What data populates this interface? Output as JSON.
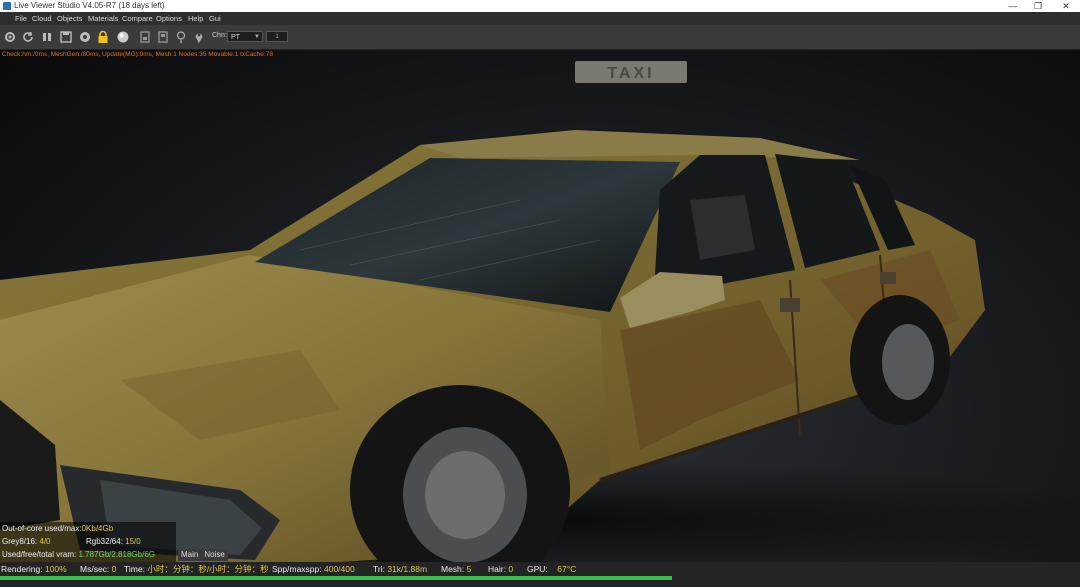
{
  "window": {
    "title": "Live Viewer Studio V4.05-R7 (18 days left)",
    "controls": [
      "—",
      "❐",
      "✕"
    ]
  },
  "menu": [
    "File",
    "Cloud",
    "Objects",
    "Materials",
    "Compare",
    "Options",
    "Help",
    "Gui"
  ],
  "toolbar": {
    "icons": [
      "gear-icon",
      "refresh-icon",
      "pause-icon",
      "save-icon",
      "settings-icon",
      "lock-icon",
      "sphere-icon",
      "region-icon",
      "region-icon",
      "locator-icon",
      "locator-icon",
      "pin-icon"
    ],
    "channel_label": "Chn:",
    "channel_value": "PT",
    "stepper_value": "1"
  },
  "viewport": {
    "status_text": "Check:hm:/0ms, MeshGen:/80ms, Update(MG):0ms, Mesh:1 Nodes:35 Movable:1 txCache:78",
    "taxi_sign_text": "TAXI"
  },
  "info": {
    "out_of_core_label": "Out-of-core used/max:",
    "out_of_core_value": "0Kb/4Gb",
    "grey_label": "Grey8/16:",
    "grey_value": "4/0",
    "rgb_label": "Rgb32/64:",
    "rgb_value": "15/0",
    "vram_label": "Used/free/total vram:",
    "vram_value": "1.787Gb/2.818Gb/6G"
  },
  "tabs": [
    "Main",
    "Noise"
  ],
  "bottom": {
    "rendering_label": "Rendering:",
    "rendering_value": "100%",
    "ms_label": "Ms/sec:",
    "ms_value": "0",
    "time_label": "Time:",
    "time_value": "小时：分钟：秒/小时：分钟：秒",
    "spp_label": "Spp/maxspp:",
    "spp_value": "400/400",
    "tri_label": "Tri:",
    "tri_value": "31k/1.88m",
    "mesh_label": "Mesh:",
    "mesh_value": "5",
    "hair_label": "Hair:",
    "hair_value": "0",
    "gpu_label": "GPU:",
    "gpu_value": "67°C",
    "progress": 1.0
  }
}
